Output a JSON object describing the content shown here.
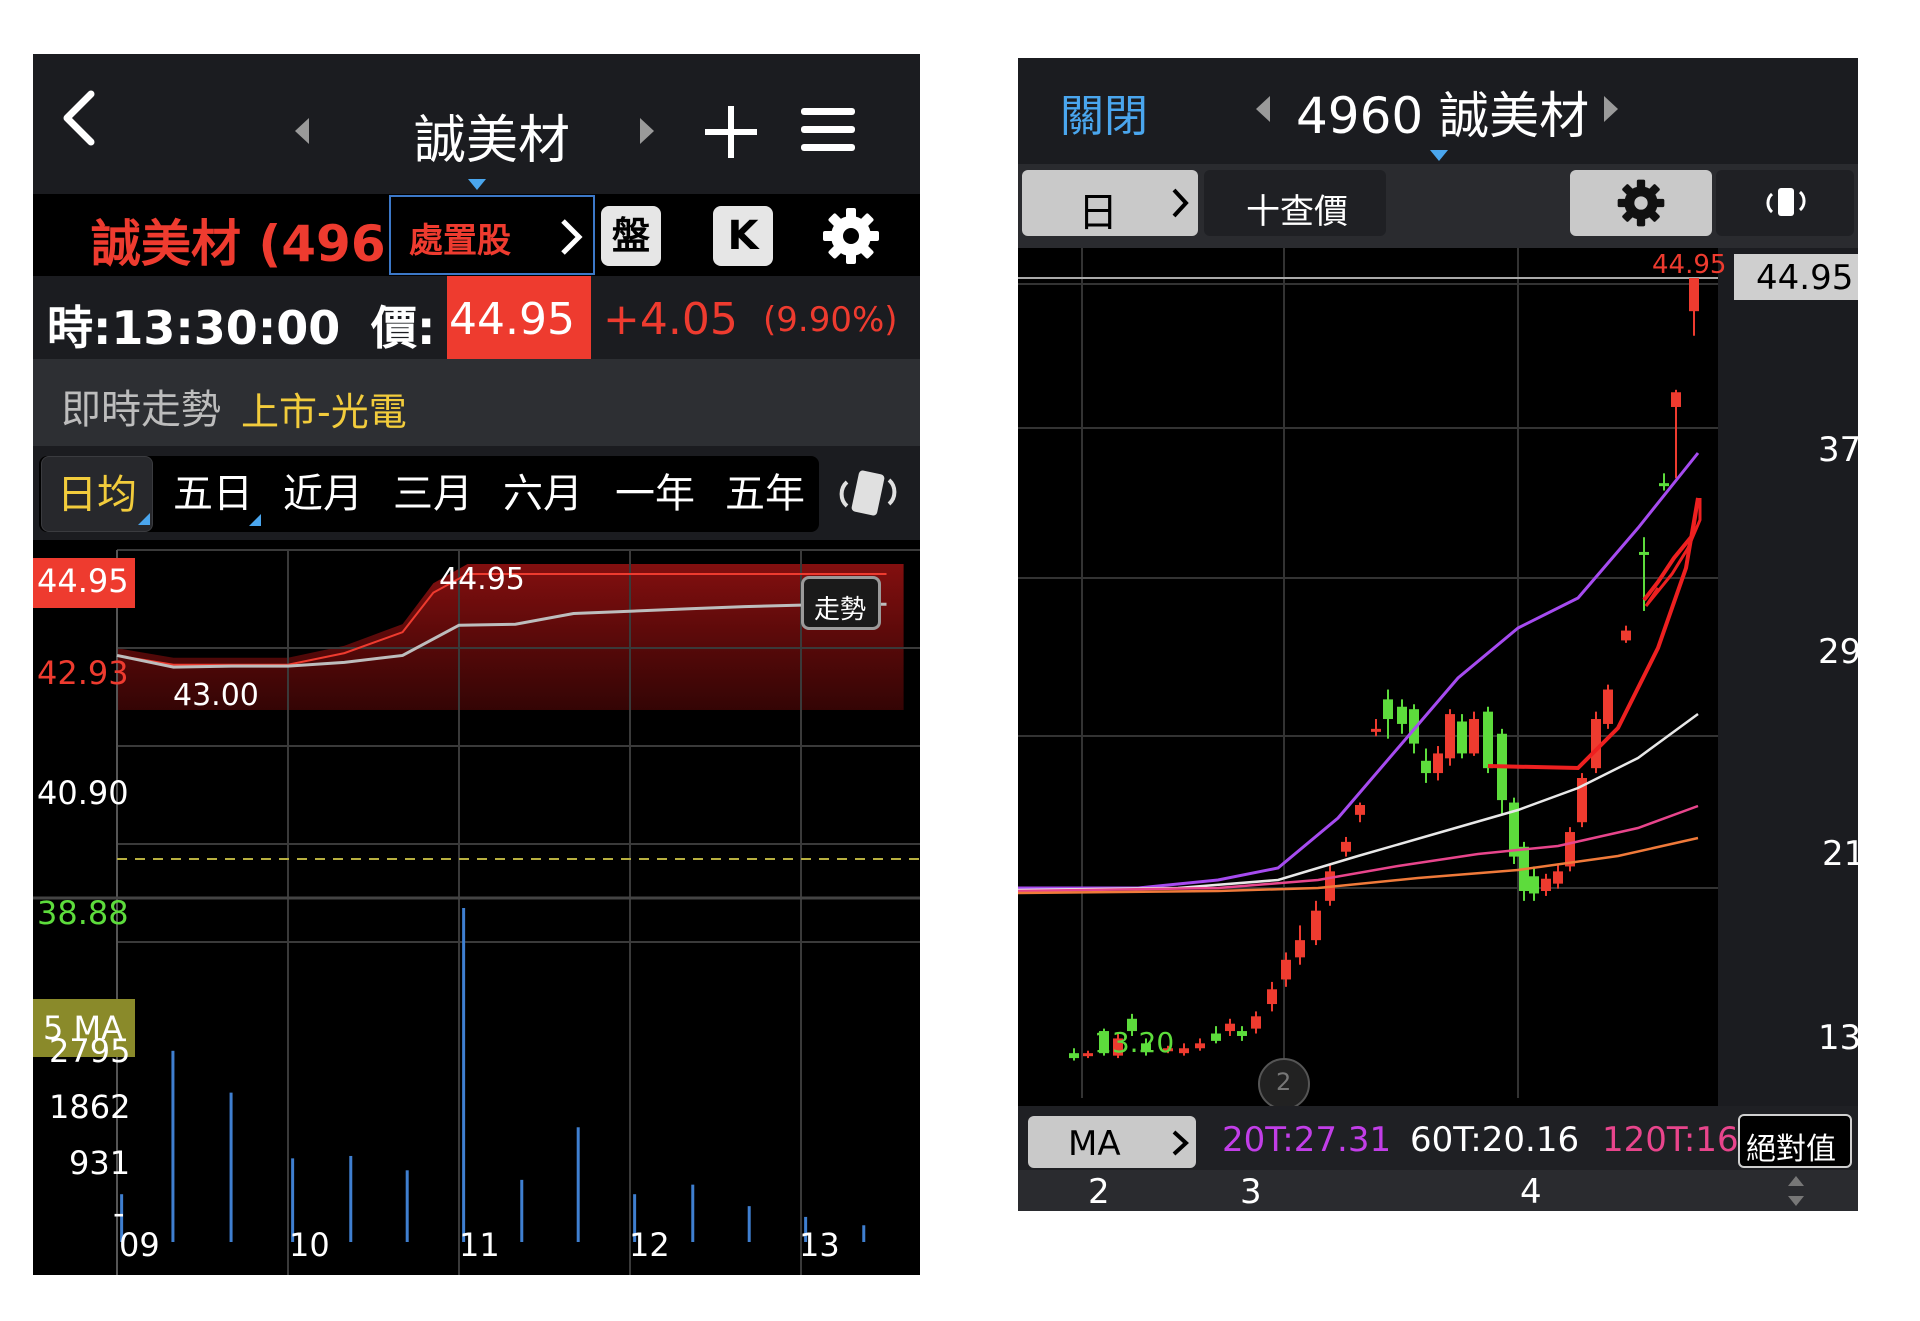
{
  "left": {
    "nav": {
      "title": "誠美材"
    },
    "info": {
      "stock_name": "誠美材 (496",
      "disposal_label": "處置股",
      "pan_label": "盤",
      "k_label": "K",
      "time_label": "時:13:30:00",
      "price_label": "價:",
      "price": "44.95",
      "change": "+4.05",
      "change_pct": "(9.90%)"
    },
    "section": {
      "title": "即時走勢",
      "market": "上市-光電"
    },
    "tabs": [
      "日均",
      "五日",
      "近月",
      "三月",
      "六月",
      "一年",
      "五年"
    ],
    "colors": {
      "up": "#ee3b2f",
      "down": "#5ddc3c",
      "accent": "#f2cc3c",
      "link": "#4aa6ee"
    }
  },
  "right": {
    "nav": {
      "close_label": "關閉",
      "title": "4960 誠美材"
    },
    "toolbar": {
      "period_label": "日",
      "query_label": "十查價"
    },
    "ma": {
      "label": "MA",
      "ma20": "20T:27.31",
      "ma60": "60T:20.16",
      "ma120": "120T:16",
      "abs_label": "絕對值"
    },
    "badge": "2"
  },
  "chart_data": [
    {
      "type": "line",
      "title": "",
      "x_ticks": [
        "09",
        "10",
        "11",
        "12",
        "13"
      ],
      "y_ticks": [
        "44.95",
        "42.93",
        "40.90",
        "38.88"
      ],
      "ylim": [
        38.88,
        44.95
      ],
      "ma_label": "5 MA",
      "annotations": [
        "44.95",
        "43.00"
      ],
      "trend_button": "走勢",
      "series": [
        {
          "values": [
            [
              9.0,
              43.2
            ],
            [
              9.33,
              42.95
            ],
            [
              9.67,
              42.97
            ],
            [
              10.0,
              42.97
            ],
            [
              10.33,
              43.05
            ],
            [
              10.67,
              43.2
            ],
            [
              11.0,
              43.85
            ],
            [
              11.33,
              43.87
            ],
            [
              11.67,
              44.1
            ],
            [
              12.0,
              44.15
            ],
            [
              12.33,
              44.2
            ],
            [
              12.67,
              44.25
            ],
            [
              13.0,
              44.28
            ],
            [
              13.33,
              44.3
            ],
            [
              13.5,
              44.3
            ]
          ]
        },
        {
          "values": [
            [
              9.0,
              43.2
            ],
            [
              9.33,
              43.0
            ],
            [
              9.67,
              43.0
            ],
            [
              10.0,
              43.0
            ],
            [
              10.33,
              43.25
            ],
            [
              10.67,
              43.7
            ],
            [
              10.85,
              44.55
            ],
            [
              11.05,
              44.95
            ],
            [
              13.5,
              44.95
            ]
          ]
        }
      ],
      "volume": {
        "y_ticks": [
          "2795",
          "1862",
          "931",
          "-"
        ],
        "x": [
          9.03,
          9.33,
          9.67,
          10.03,
          10.37,
          10.7,
          11.03,
          11.37,
          11.7,
          12.03,
          12.37,
          12.7,
          13.03,
          13.37
        ],
        "values": [
          400,
          1600,
          1250,
          700,
          720,
          600,
          2795,
          520,
          960,
          400,
          480,
          300,
          210,
          140
        ]
      }
    },
    {
      "type": "candlestick",
      "title": "",
      "x_ticks": [
        "2",
        "3",
        "4"
      ],
      "y_ticks": [
        "44.95",
        "37",
        "29",
        "21",
        "13"
      ],
      "ylim": [
        13,
        44.95
      ],
      "annotations": [
        "44.95",
        "13.20"
      ],
      "ma_series": [
        "20T",
        "60T",
        "120T"
      ]
    }
  ]
}
